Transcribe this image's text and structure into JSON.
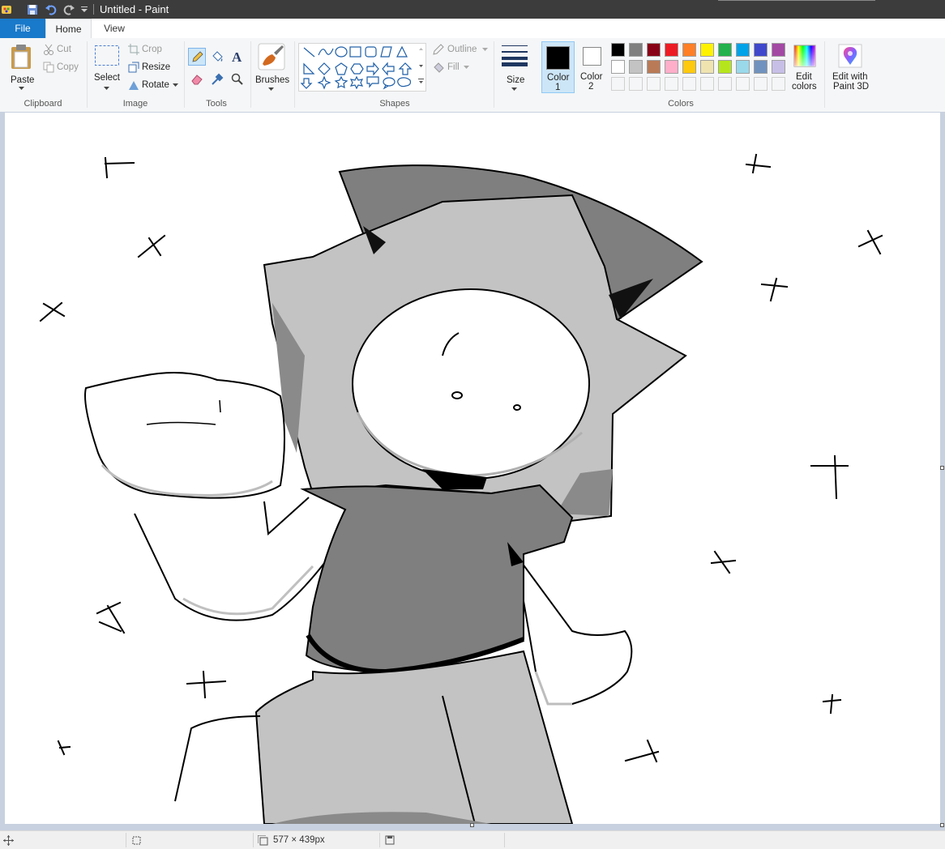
{
  "window": {
    "title": "Untitled - Paint"
  },
  "tabs": {
    "file": "File",
    "home": "Home",
    "view": "View"
  },
  "clipboard": {
    "paste": "Paste",
    "cut": "Cut",
    "copy": "Copy",
    "label": "Clipboard"
  },
  "image": {
    "select": "Select",
    "crop": "Crop",
    "resize": "Resize",
    "rotate": "Rotate",
    "label": "Image"
  },
  "tools": {
    "label": "Tools"
  },
  "brushes": {
    "label": "Brushes"
  },
  "shapes": {
    "outline": "Outline",
    "fill": "Fill",
    "label": "Shapes"
  },
  "size": {
    "label": "Size"
  },
  "colors": {
    "color1": "Color",
    "color1_num": "1",
    "color2": "Color",
    "color2_num": "2",
    "edit_colors_1": "Edit",
    "edit_colors_2": "colors",
    "label": "Colors",
    "color1_value": "#000000",
    "color2_value": "#ffffff",
    "palette_row1": [
      "#000000",
      "#7f7f7f",
      "#880015",
      "#ed1c24",
      "#ff7f27",
      "#fff200",
      "#22b14c",
      "#00a2e8",
      "#3f48cc",
      "#a349a4"
    ],
    "palette_row2": [
      "#ffffff",
      "#c3c3c3",
      "#b97a57",
      "#ffaec9",
      "#ffc90e",
      "#efe4b0",
      "#b5e61d",
      "#99d9ea",
      "#7092be",
      "#c8bfe7"
    ]
  },
  "paint3d": {
    "line1": "Edit with",
    "line2": "Paint 3D"
  },
  "status": {
    "dimensions": "577 × 439px"
  }
}
